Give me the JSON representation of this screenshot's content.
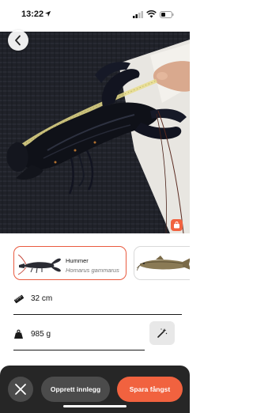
{
  "status_bar": {
    "time": "13:22",
    "icons": [
      "location-arrow-icon",
      "signal-icon",
      "wifi-icon",
      "battery-icon"
    ]
  },
  "photo": {
    "subject": "lobster-photo"
  },
  "species": [
    {
      "common_name": "Hummer",
      "latin_name": "Homarus gammarus",
      "selected": true,
      "icon": "lobster-icon"
    },
    {
      "common_name": "",
      "latin_name": "",
      "selected": false,
      "icon": "catfish-icon"
    }
  ],
  "measurements": {
    "length": "32 cm",
    "weight": "985 g",
    "length_icon": "ruler-icon",
    "weight_icon": "weight-icon",
    "estimate_icon": "magic-wand-icon"
  },
  "actions": {
    "close_icon": "close-icon",
    "create_post_label": "Opprett innlegg",
    "save_catch_label": "Spara fångst"
  },
  "colors": {
    "accent": "#f1623f",
    "bottom_bar": "#262626",
    "button_dark": "#4b4b4b"
  }
}
